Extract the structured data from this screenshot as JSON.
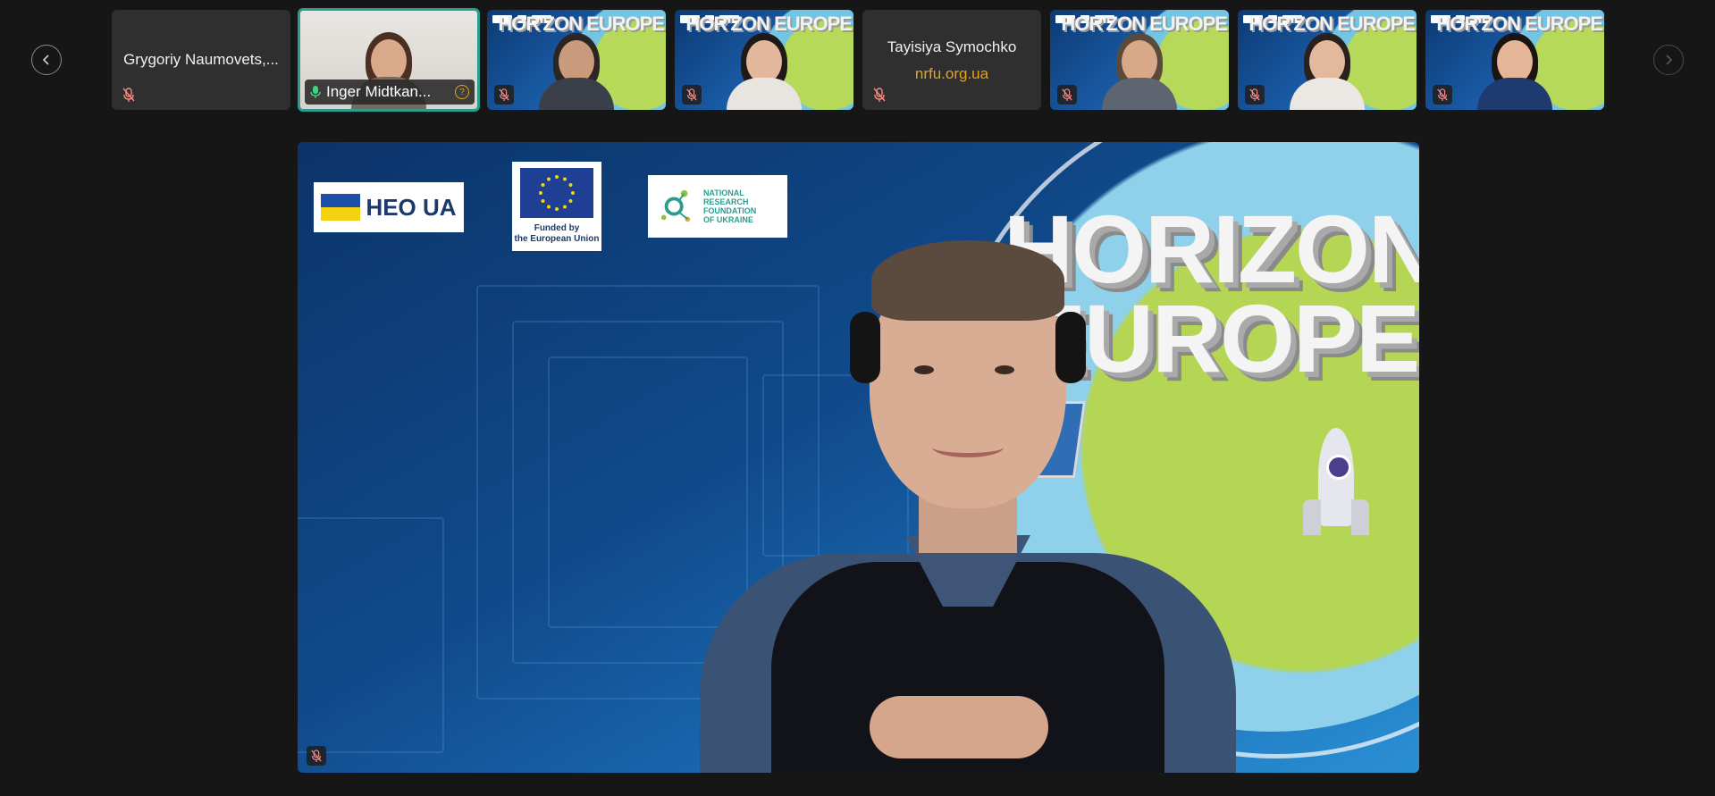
{
  "participants": [
    {
      "name": "Grygoriy Naumovets,...",
      "muted": true,
      "video": false
    },
    {
      "name": "Inger Midtkan...",
      "muted": false,
      "video": true,
      "active": true
    },
    {
      "name": "",
      "muted": true,
      "video": true
    },
    {
      "name": "",
      "muted": true,
      "video": true
    },
    {
      "name": "Tayisiya Symochko",
      "subtitle": "nrfu.org.ua",
      "muted": true,
      "video": false
    },
    {
      "name": "",
      "muted": true,
      "video": true
    },
    {
      "name": "",
      "muted": true,
      "video": true
    },
    {
      "name": "",
      "muted": true,
      "video": true
    }
  ],
  "thumbnail_banner_text": "HOR'ZON EUROPE",
  "main_video": {
    "banner_word_1": "HORIZON",
    "banner_word_2": "EUROPE",
    "logo_heo": "HEO UA",
    "logo_eu_caption_1": "Funded by",
    "logo_eu_caption_2": "the European Union",
    "logo_nrfu_1": "NATIONAL RESEARCH",
    "logo_nrfu_2": "FOUNDATION",
    "logo_nrfu_3": "OF UKRAINE",
    "muted": true
  },
  "colors": {
    "background": "#161616",
    "tile": "#2f2f2f",
    "active_border": "#2a9d8f",
    "muted_icon": "#f28b82",
    "subtitle": "#e8a317"
  },
  "icons": {
    "prev": "chevron-left-icon",
    "next": "chevron-right-icon",
    "mic_muted": "mic-off-icon",
    "mic_on": "mic-icon",
    "hand": "raise-hand-icon"
  }
}
